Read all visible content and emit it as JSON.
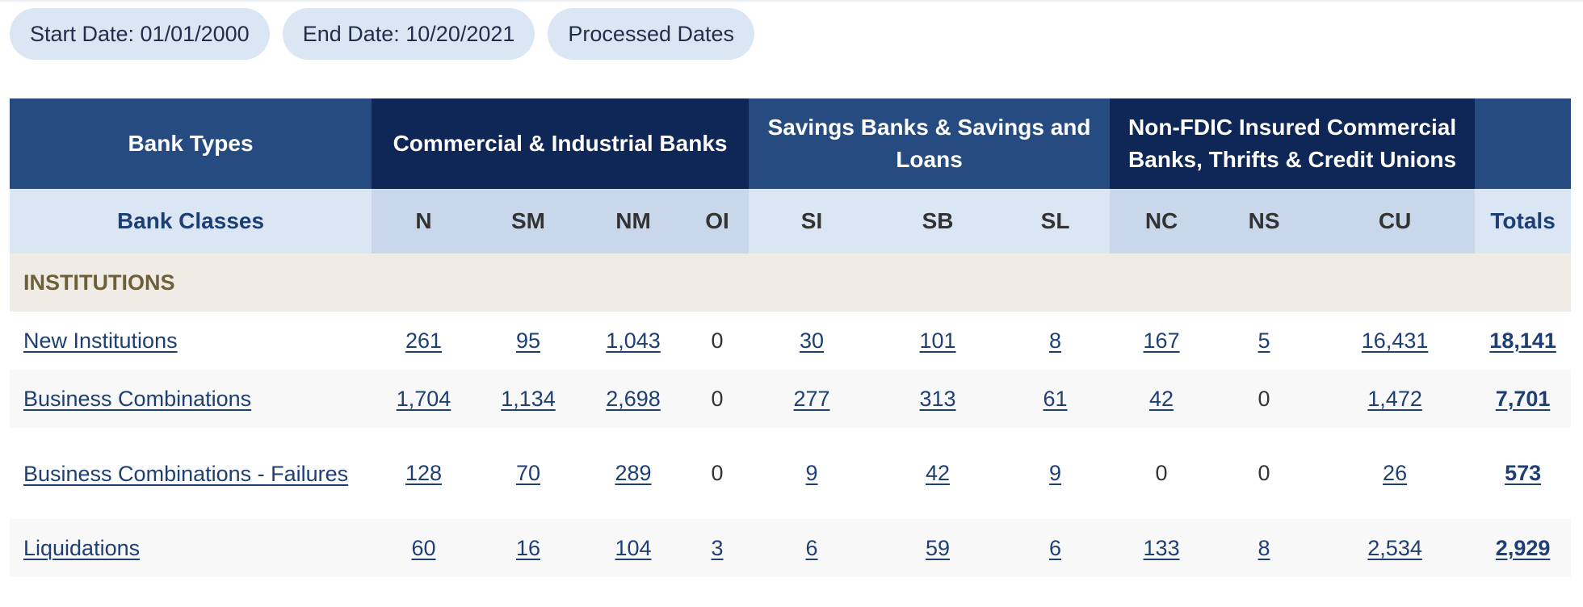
{
  "filters": {
    "start_date": "Start Date: 01/01/2000",
    "end_date": "End Date: 10/20/2021",
    "processed_dates": "Processed Dates"
  },
  "table": {
    "bank_types_label": "Bank Types",
    "groups": {
      "commercial": "Commercial & Industrial Banks",
      "savings": "Savings Banks & Savings and Loans",
      "non_fdic": "Non-FDIC Insured Commercial Banks, Thrifts & Credit Unions"
    },
    "bank_classes_label": "Bank Classes",
    "classes": [
      "N",
      "SM",
      "NM",
      "OI",
      "SI",
      "SB",
      "SL",
      "NC",
      "NS",
      "CU"
    ],
    "totals_label": "Totals",
    "section": "INSTITUTIONS",
    "rows": [
      {
        "label": "New Institutions",
        "values": [
          "261",
          "95",
          "1,043",
          "0",
          "30",
          "101",
          "8",
          "167",
          "5",
          "16,431"
        ],
        "total": "18,141"
      },
      {
        "label": "Business Combinations",
        "values": [
          "1,704",
          "1,134",
          "2,698",
          "0",
          "277",
          "313",
          "61",
          "42",
          "0",
          "1,472"
        ],
        "total": "7,701"
      },
      {
        "label": "Business Combinations - Failures",
        "values": [
          "128",
          "70",
          "289",
          "0",
          "9",
          "42",
          "9",
          "0",
          "0",
          "26"
        ],
        "total": "573"
      },
      {
        "label": "Liquidations",
        "values": [
          "60",
          "16",
          "104",
          "3",
          "6",
          "59",
          "6",
          "133",
          "8",
          "2,534"
        ],
        "total": "2,929"
      }
    ]
  },
  "colors": {
    "header_dark": "#0e2756",
    "header_mid": "#264b81",
    "class_light": "#dae6f4",
    "class_mid": "#c9d7ea",
    "section_bg": "#efece5",
    "link": "#1e3f74"
  }
}
